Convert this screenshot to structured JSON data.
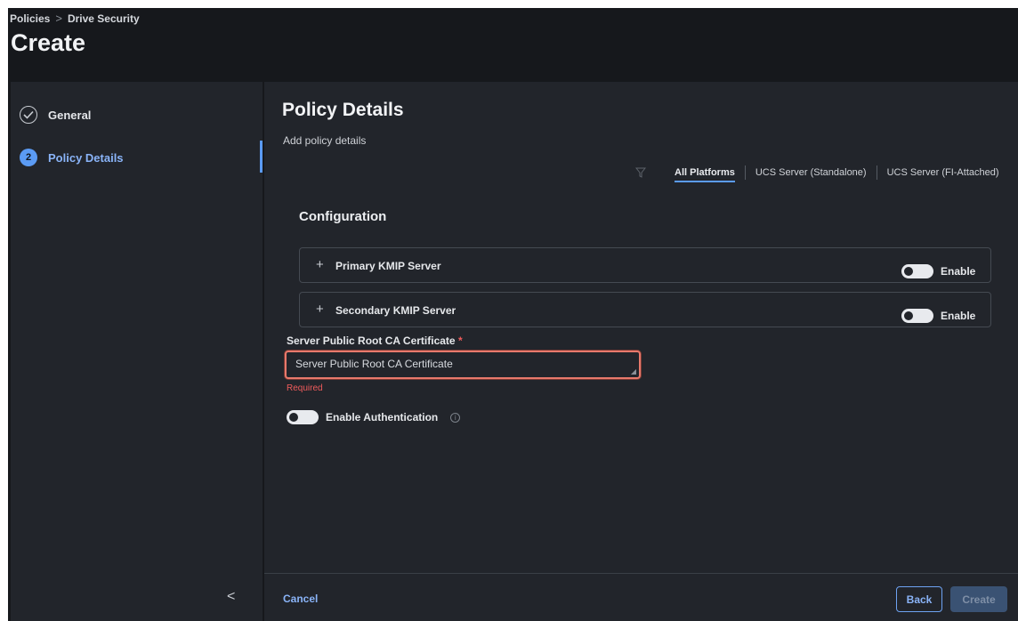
{
  "breadcrumb": {
    "items": [
      "Policies",
      "Drive Security"
    ],
    "separator": ">"
  },
  "page": {
    "title": "Create"
  },
  "steps": [
    {
      "label": "General",
      "state": "completed",
      "icon": "check-circle-icon"
    },
    {
      "label": "Policy Details",
      "state": "active",
      "number": "2"
    }
  ],
  "sidebar": {
    "collapse_glyph": "<"
  },
  "main": {
    "title": "Policy Details",
    "subtitle": "Add policy details",
    "platform_tabs": [
      "All Platforms",
      "UCS Server (Standalone)",
      "UCS Server (FI-Attached)"
    ],
    "active_platform": "All Platforms",
    "section_title": "Configuration",
    "kmip": {
      "primary_label": "Primary KMIP Server",
      "secondary_label": "Secondary KMIP Server",
      "enable_label": "Enable"
    },
    "cert": {
      "label": "Server Public Root CA Certificate",
      "required_mark": "*",
      "placeholder": "Server Public Root CA Certificate",
      "error": "Required"
    },
    "auth": {
      "label": "Enable Authentication",
      "info_glyph": "i"
    }
  },
  "footer": {
    "cancel_label": "Cancel",
    "back_label": "Back",
    "create_label": "Create"
  },
  "colors": {
    "accent": "#5b9bf4",
    "error": "#ef5b5b",
    "panel": "#22252b",
    "background": "#16181c"
  }
}
